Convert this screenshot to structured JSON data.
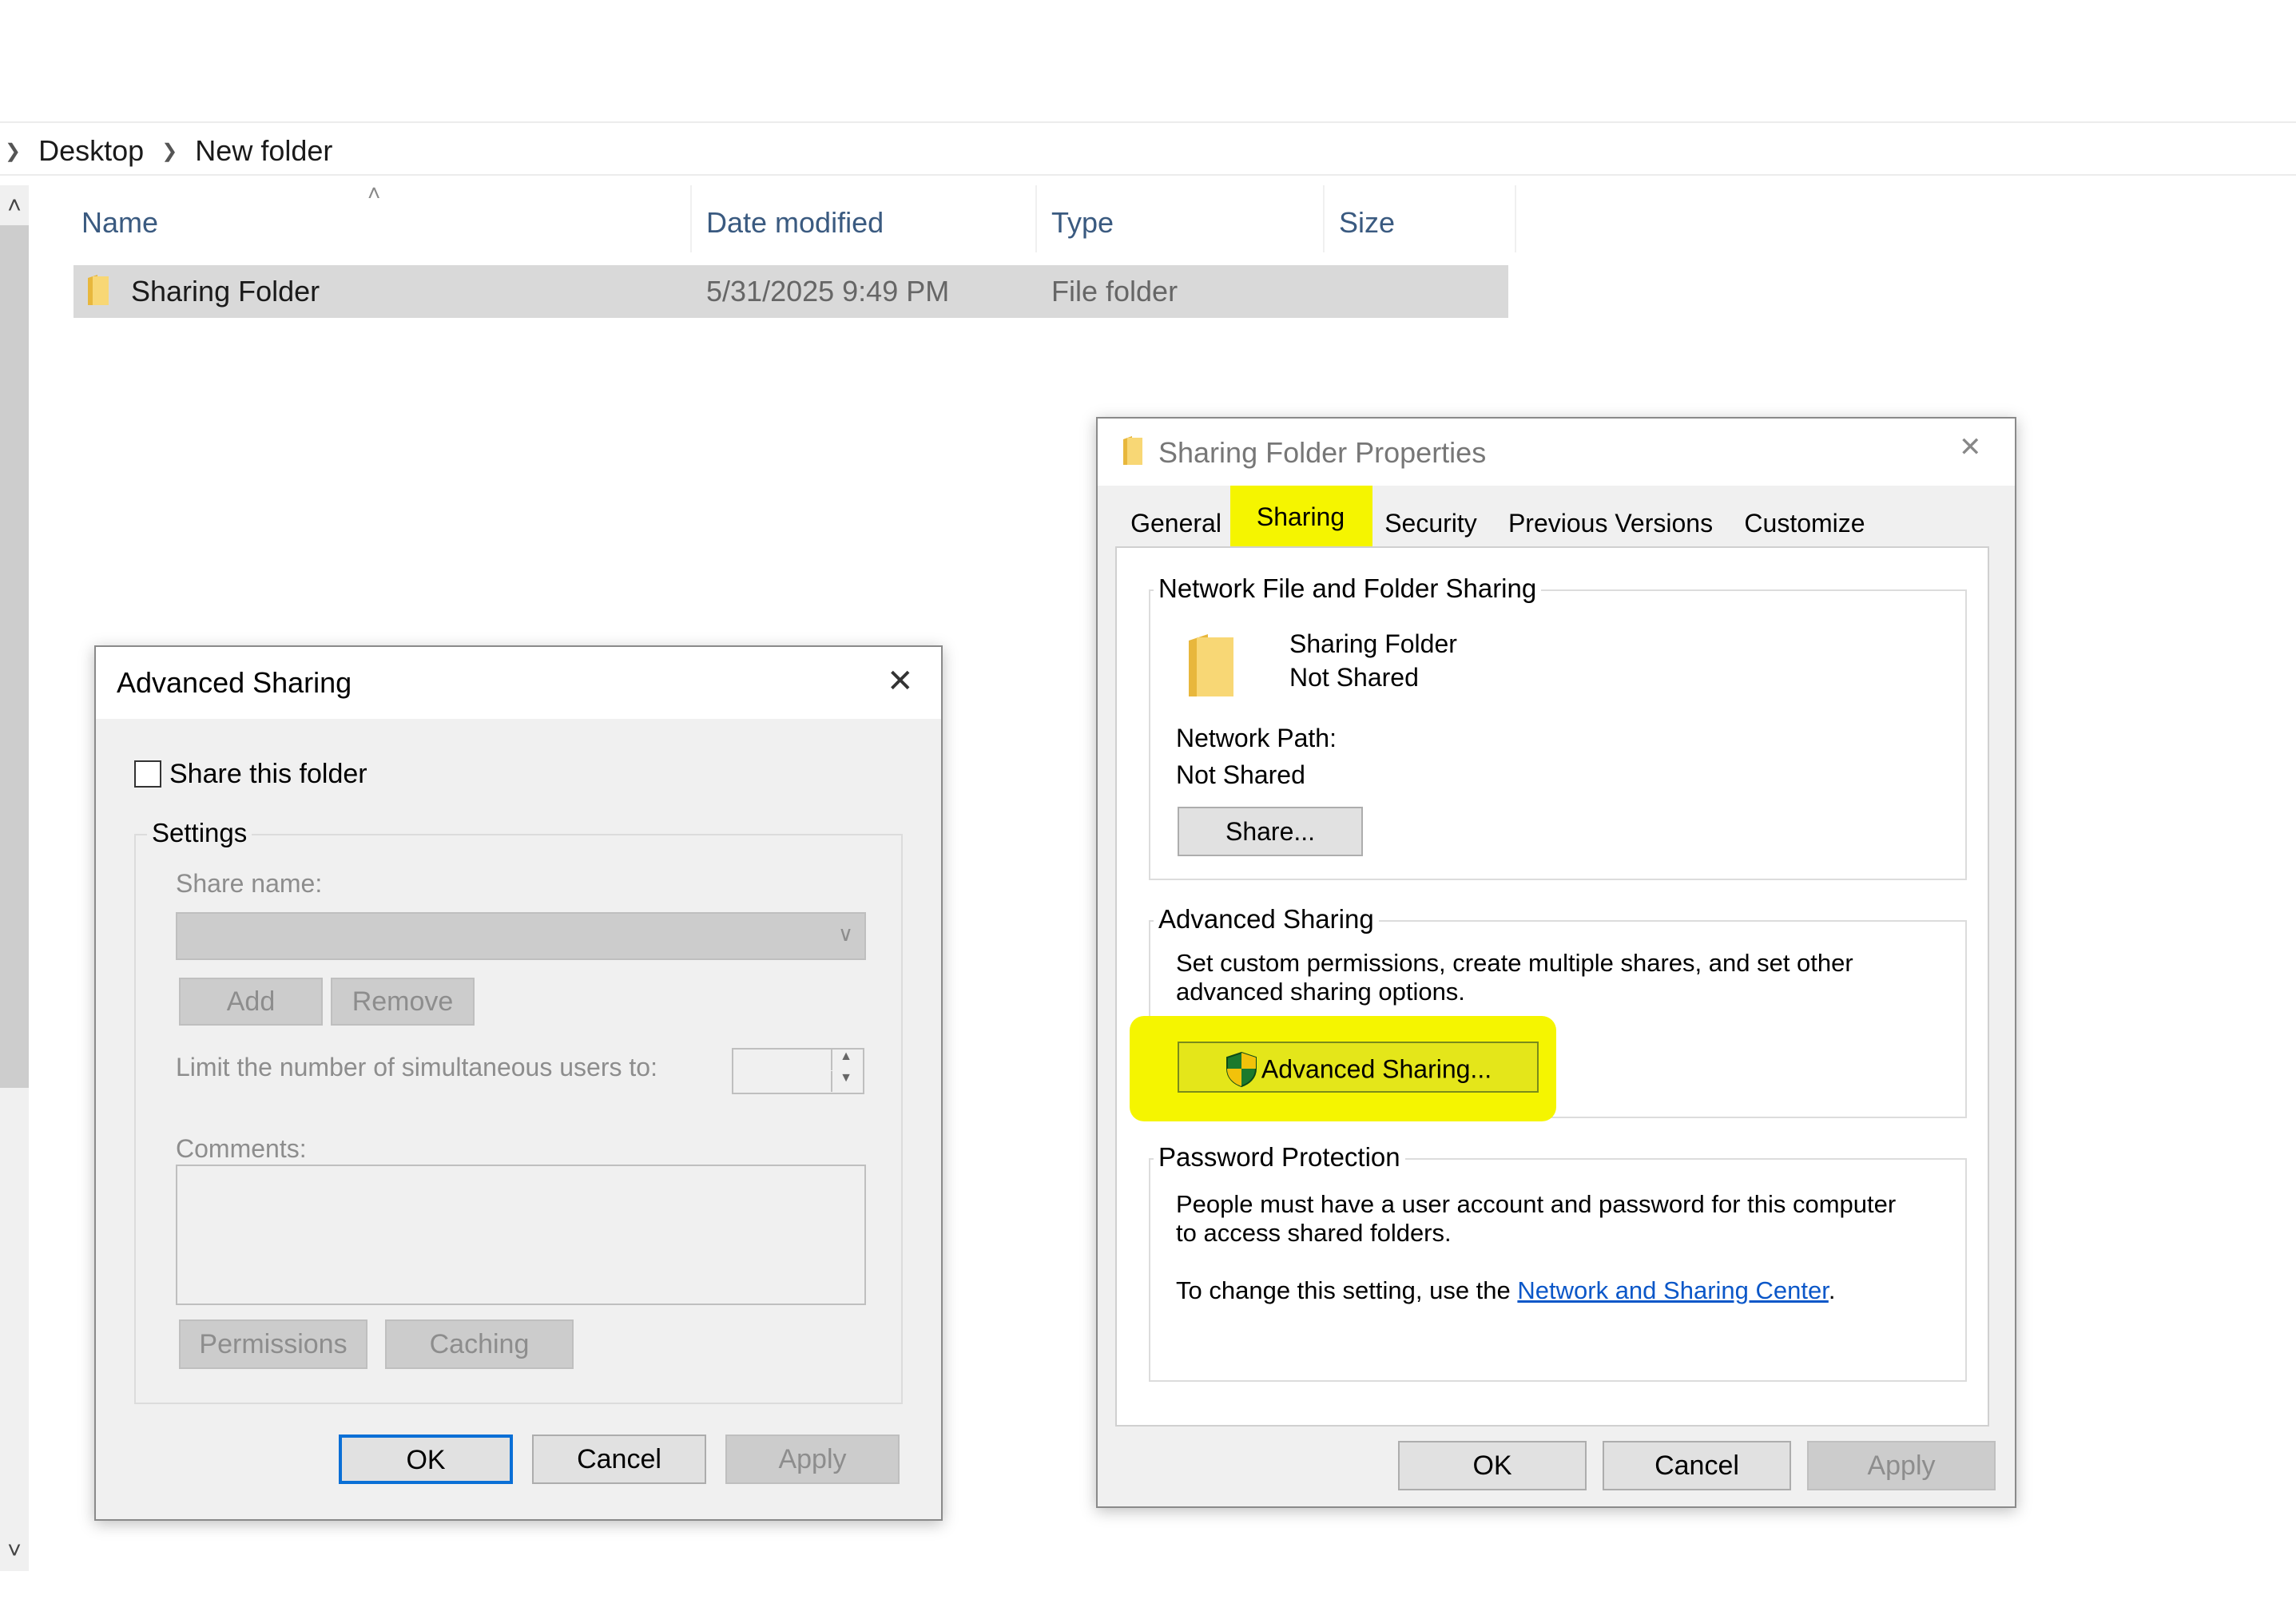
{
  "breadcrumb": [
    "Desktop",
    "New folder"
  ],
  "columns": {
    "name": "Name",
    "date": "Date modified",
    "type": "Type",
    "size": "Size"
  },
  "row": {
    "name": "Sharing Folder",
    "date": "5/31/2025 9:49 PM",
    "type": "File folder",
    "size": ""
  },
  "advanced_sharing": {
    "title": "Advanced Sharing",
    "share_checkbox": "Share this folder",
    "share_checked": false,
    "settings_group": "Settings",
    "share_name_label": "Share name:",
    "share_name_value": "",
    "add_button": "Add",
    "remove_button": "Remove",
    "limit_label": "Limit the number of simultaneous users to:",
    "limit_value": "",
    "comments_label": "Comments:",
    "comments_value": "",
    "permissions_button": "Permissions",
    "caching_button": "Caching",
    "ok": "OK",
    "cancel": "Cancel",
    "apply": "Apply"
  },
  "properties": {
    "title": "Sharing Folder Properties",
    "tabs": [
      "General",
      "Sharing",
      "Security",
      "Previous Versions",
      "Customize"
    ],
    "selected_tab": "Sharing",
    "network_group": "Network File and Folder Sharing",
    "folder_name": "Sharing Folder",
    "folder_status": "Not Shared",
    "network_path_label": "Network Path:",
    "network_path_value": "Not Shared",
    "share_button": "Share...",
    "advanced_group": "Advanced Sharing",
    "advanced_desc_1": "Set custom permissions, create multiple shares, and set other",
    "advanced_desc_2": "advanced sharing options.",
    "advanced_button": "Advanced Sharing...",
    "password_group": "Password Protection",
    "password_desc_1": "People must have a user account and password for this computer",
    "password_desc_2": "to access shared folders.",
    "change_prefix": "To change this setting, use the ",
    "change_link": "Network and Sharing Center",
    "change_suffix": ".",
    "ok": "OK",
    "cancel": "Cancel",
    "apply": "Apply"
  },
  "colors": {
    "highlight": "#f5f500",
    "link": "#0b57c8",
    "selection": "#d9d9d9",
    "header_text": "#3a5a80"
  },
  "icons": [
    "chevron-right-icon",
    "folder-icon",
    "close-icon",
    "shield-icon",
    "chevron-down-icon",
    "spin-up-icon",
    "spin-down-icon",
    "scroll-up-icon",
    "scroll-down-icon",
    "sort-up-icon"
  ]
}
